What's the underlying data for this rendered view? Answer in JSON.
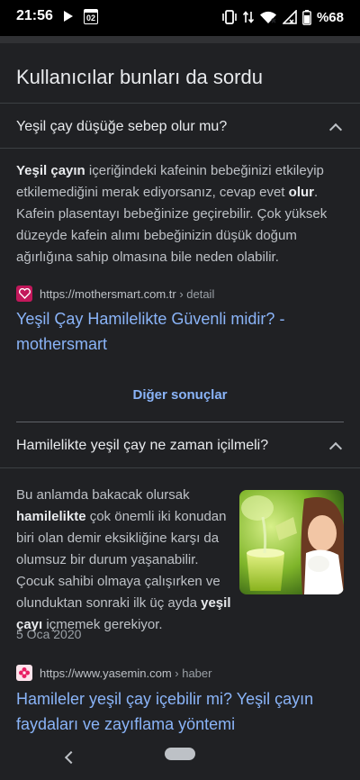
{
  "status_bar": {
    "time": "21:56",
    "calendar_day": "02",
    "battery_percent": "%68"
  },
  "section_title": "Kullanıcılar bunları da sordu",
  "items": [
    {
      "question": "Yeşil çay düşüğe sebep olur mu?",
      "answer": [
        {
          "t": "Yeşil çayın",
          "b": true
        },
        {
          "t": " içeriğindeki kafeinin bebeğinizi etkileyip etkilemediğini merak ediyorsanız, cevap evet ",
          "b": false
        },
        {
          "t": "olur",
          "b": true
        },
        {
          "t": ". Kafein plasentayı bebeğinize geçirebilir. Çok yüksek düzeyde kafein alımı bebeğinizin düşük doğum ağırlığına sahip olmasına bile neden olabilir.",
          "b": false
        }
      ],
      "source_url": "https://mothersmart.com.tr",
      "source_crumb": " › detail",
      "link_text": "Yeşil Çay Hamilelikte Güvenli midir? - mothersmart"
    },
    {
      "question": "Hamilelikte yeşil çay ne zaman içilmeli?",
      "answer": [
        {
          "t": "Bu anlamda bakacak olursak ",
          "b": false
        },
        {
          "t": "hamilelikte",
          "b": true
        },
        {
          "t": " çok önemli iki konudan biri olan demir eksikliğine karşı da olumsuz bir durum yaşanabilir. Çocuk sahibi olmaya çalışırken ve olunduktan sonraki ilk üç ayda ",
          "b": false
        },
        {
          "t": "yeşil çayı",
          "b": true
        },
        {
          "t": " içmemek gerekiyor.",
          "b": false
        }
      ],
      "date": "5 Oca 2020",
      "source_url": "https://www.yasemin.com",
      "source_crumb": " › haber",
      "link_text": "Hamileler yeşil çay içebilir mi? Yeşil çayın faydaları ve zayıflama yöntemi"
    }
  ],
  "more_results": "Diğer sonuçlar",
  "colors": {
    "link": "#8ab4f8",
    "background": "#202124",
    "mothersmart_favicon": "#c2185b",
    "yasemin_favicon": "#e91e63"
  }
}
